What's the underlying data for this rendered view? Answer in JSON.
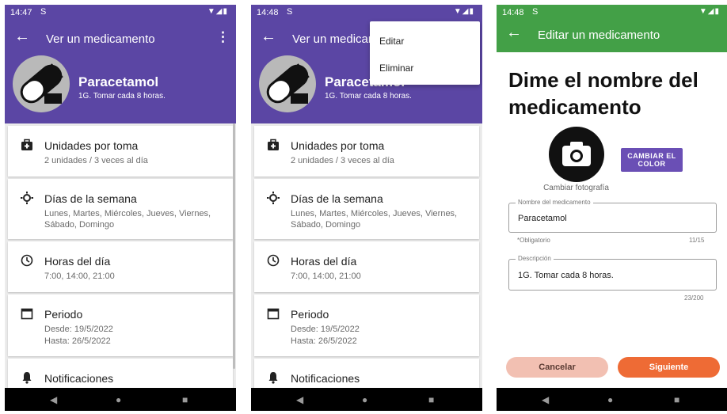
{
  "screens": [
    {
      "status": {
        "time": "14:47",
        "sim": "S",
        "signal": "▼◢▮"
      },
      "appbar": {
        "back": "←",
        "title": "Ver un medicamento",
        "menu": "⋮"
      },
      "med": {
        "name": "Paracetamol",
        "desc": "1G. Tomar cada 8 horas."
      },
      "cards": [
        {
          "title": "Unidades por toma",
          "sub": "2 unidades / 3 veces al día"
        },
        {
          "title": "Días de la semana",
          "sub": "Lunes, Martes, Miércoles, Jueves, Viernes, Sábado, Domingo"
        },
        {
          "title": "Horas del día",
          "sub": "7:00, 14:00, 21:00"
        },
        {
          "title": "Periodo",
          "sub1": "Desde: 19/5/2022",
          "sub2": "Hasta: 26/5/2022"
        },
        {
          "title": "Notificaciones"
        }
      ]
    },
    {
      "status": {
        "time": "14:48",
        "sim": "S",
        "signal": "▼◢▮"
      },
      "appbar": {
        "back": "←",
        "title": "Ver un medicamento"
      },
      "med": {
        "name": "Paracetamol",
        "desc": "1G. Tomar cada 8 horas."
      },
      "menu": {
        "items": [
          "Editar",
          "Eliminar"
        ]
      },
      "cards": [
        {
          "title": "Unidades por toma",
          "sub": "2 unidades / 3 veces al día"
        },
        {
          "title": "Días de la semana",
          "sub": "Lunes, Martes, Miércoles, Jueves, Viernes, Sábado, Domingo"
        },
        {
          "title": "Horas del día",
          "sub": "7:00, 14:00, 21:00"
        },
        {
          "title": "Periodo",
          "sub1": "Desde: 19/5/2022",
          "sub2": "Hasta: 26/5/2022"
        },
        {
          "title": "Notificaciones"
        }
      ]
    },
    {
      "status": {
        "time": "14:48",
        "sim": "S",
        "signal": "▼◢▮"
      },
      "appbar": {
        "back": "←",
        "title": "Editar un medicamento"
      },
      "heading": "Dime el nombre del medicamento",
      "photo_caption": "Cambiar fotografía",
      "color_button": "CAMBIAR EL COLOR",
      "name_field": {
        "label": "Nombre del medicamento",
        "value": "Paracetamol",
        "helper": "*Obligatorio",
        "counter": "11/15"
      },
      "desc_field": {
        "label": "Descripción",
        "value": "1G. Tomar cada 8 horas.",
        "counter": "23/200"
      },
      "cancel": "Cancelar",
      "next": "Siguiente"
    }
  ],
  "navbar": {
    "back": "◀",
    "home": "●",
    "recent": "■"
  },
  "colors": {
    "purple": "#5b46a4",
    "green": "#43a047",
    "accent_orange": "#ee6b35",
    "cancel_peach": "#f2c0b2",
    "color_button": "#6a4fb5"
  },
  "icons": [
    "medical-bag-icon",
    "sun-icon",
    "clock-icon",
    "calendar-icon",
    "bell-icon",
    "camera-icon",
    "pill-icon"
  ]
}
